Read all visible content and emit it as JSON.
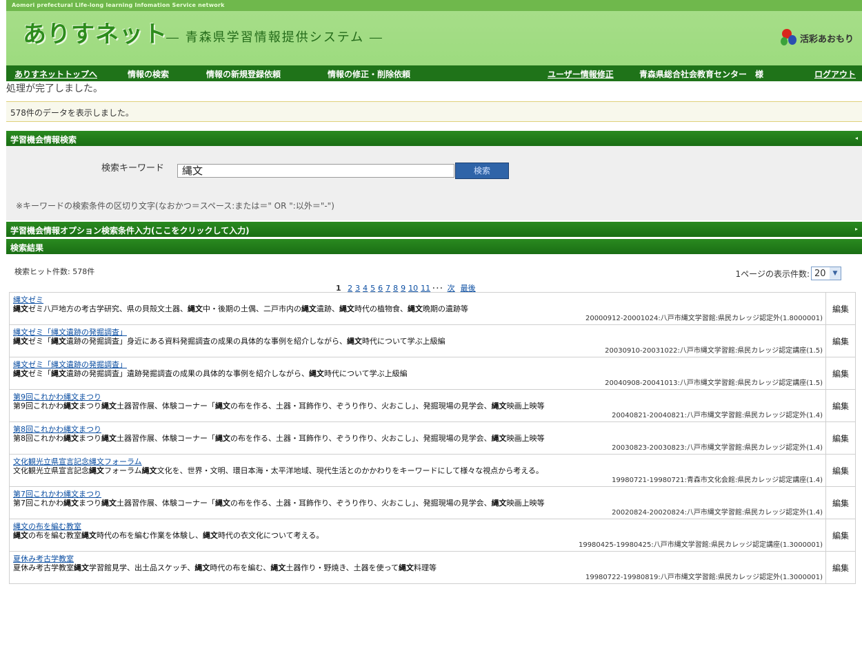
{
  "header": {
    "top_strip": "Aomori prefectural Life-long learning Infomation Service network",
    "logo": "ありすネット",
    "subtitle": "― 青森県学習情報提供システム ―",
    "brand": "活彩あおもり"
  },
  "nav": {
    "items": [
      "ありすネットトップへ",
      "情報の検索",
      "情報の新規登録依頼",
      "情報の修正・削除依頼"
    ],
    "user_edit": "ユーザー情報修正",
    "user_name": "青森県総合社会教育センター　様",
    "logout": "ログアウト"
  },
  "messages": {
    "done": "処理が完了しました。",
    "info": "578件のデータを表示しました。"
  },
  "search": {
    "section_title": "学習機会情報検索",
    "keyword_label": "検索キーワード",
    "keyword_value": "縄文",
    "button": "検索",
    "note": "※キーワードの検索条件の区切り文字(なおかつ＝スペース:または＝\" OR \":以外＝\"-\")"
  },
  "options": {
    "section_title": "学習機会情報オプション検索条件入力(ここをクリックして入力)"
  },
  "results": {
    "section_title": "検索結果",
    "hit_count": "検索ヒット件数: 578件",
    "per_page_label": "1ページの表示件数:",
    "per_page_value": "20",
    "pager": {
      "current": "1",
      "pages": [
        "2",
        "3",
        "4",
        "5",
        "6",
        "7",
        "8",
        "9",
        "10",
        "11"
      ],
      "ellipsis": "･･･",
      "next": "次",
      "last": "最後"
    },
    "edit_label": "編集",
    "rows": [
      {
        "title": "縄文ゼミ",
        "desc": "縄文ゼミ八戸地方の考古学研究、県の貝殻文土器、縄文中・後期の土偶、二戸市内の縄文遺跡、縄文時代の植物食、縄文晩期の遺跡等",
        "meta": "20000912-20001024:八戸市縄文学習館:県民カレッジ認定外(1.8000001)"
      },
      {
        "title": "縄文ゼミ「縄文遺跡の発掘調査」",
        "desc": "縄文ゼミ「縄文遺跡の発掘調査」身近にある資料発掘調査の成果の具体的な事例を紹介しながら、縄文時代について学ぶ上級編",
        "meta": "20030910-20031022:八戸市縄文学習館:県民カレッジ認定講座(1.5)"
      },
      {
        "title": "縄文ゼミ「縄文遺跡の発掘調査」",
        "desc": "縄文ゼミ「縄文遺跡の発掘調査」遺跡発掘調査の成果の具体的な事例を紹介しながら、縄文時代について学ぶ上級編",
        "meta": "20040908-20041013:八戸市縄文学習館:県民カレッジ認定講座(1.5)"
      },
      {
        "title": "第9回これかわ縄文まつり",
        "desc": "第9回これかわ縄文まつり縄文土器習作展、体験コーナー「縄文の布を作る、土器・耳飾作り、ぞうり作り、火おこし」、発掘現場の見学会、縄文映画上映等",
        "meta": "20040821-20040821:八戸市縄文学習館:県民カレッジ認定外(1.4)"
      },
      {
        "title": "第8回これかわ縄文まつり",
        "desc": "第8回これかわ縄文まつり縄文土器習作展、体験コーナー「縄文の布を作る、土器・耳飾作り、ぞうり作り、火おこし」、発掘現場の見学会、縄文映画上映等",
        "meta": "20030823-20030823:八戸市縄文学習館:県民カレッジ認定外(1.4)"
      },
      {
        "title": "文化観光立県宣言記念縄文フォーラム",
        "desc": "文化観光立県宣言記念縄文フォーラム縄文文化を、世界・文明、環日本海・太平洋地域、現代生活とのかかわりをキーワードにして様々な視点から考える。",
        "meta": "19980721-19980721:青森市文化会館:県民カレッジ認定講座(1.4)"
      },
      {
        "title": "第7回これかわ縄文まつり",
        "desc": "第7回これかわ縄文まつり縄文土器習作展、体験コーナー「縄文の布を作る、土器・耳飾作り、ぞうり作り、火おこし」、発掘現場の見学会、縄文映画上映等",
        "meta": "20020824-20020824:八戸市縄文学習館:県民カレッジ認定外(1.4)"
      },
      {
        "title": "縄文の布を編む教室",
        "desc": "縄文の布を編む教室縄文時代の布を編む作業を体験し、縄文時代の衣文化について考える。",
        "meta": "19980425-19980425:八戸市縄文学習館:県民カレッジ認定講座(1.3000001)"
      },
      {
        "title": "夏休み考古学教室",
        "desc": "夏休み考古学教室縄文学習館見学、出土品スケッチ、縄文時代の布を編む、縄文土器作り・野焼き、土器を使って縄文料理等",
        "meta": "19980722-19980819:八戸市縄文学習館:県民カレッジ認定外(1.3000001)"
      }
    ]
  },
  "colors": {
    "header_bg": "#a8de8a",
    "nav_bg": "#1f7319",
    "link": "#0b4ea2",
    "button": "#2f64a8"
  }
}
